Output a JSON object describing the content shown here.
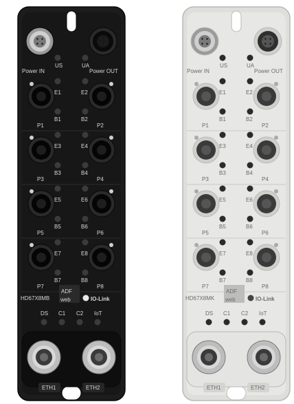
{
  "devices": [
    {
      "variant": "black",
      "labels": {
        "power_in": "Power IN",
        "us": "US",
        "ua": "UA",
        "power_out": "Power OUT",
        "e1": "E1",
        "e2": "E2",
        "b1": "B1",
        "b2": "B2",
        "p1": "P1",
        "p2": "P2",
        "e3": "E3",
        "e4": "E4",
        "b3": "B3",
        "b4": "B4",
        "p3": "P3",
        "p4": "P4",
        "e5": "E5",
        "e6": "E6",
        "b5": "B5",
        "b6": "B6",
        "p5": "P5",
        "p6": "P6",
        "e7": "E7",
        "e8": "E8",
        "b7": "B7",
        "b8": "B8",
        "p7": "P7",
        "p8": "P8",
        "model": "HD67X8MB",
        "brand_top": "ADF",
        "brand_bottom": "web",
        "iolink": "IO-Link",
        "ds": "DS",
        "c1": "C1",
        "c2": "C2",
        "iot": "IoT",
        "eth1": "ETH1",
        "eth2": "ETH2"
      }
    },
    {
      "variant": "white",
      "labels": {
        "power_in": "Power IN",
        "us": "US",
        "ua": "UA",
        "power_out": "Power OUT",
        "e1": "E1",
        "e2": "E2",
        "b1": "B1",
        "b2": "B2",
        "p1": "P1",
        "p2": "P2",
        "e3": "E3",
        "e4": "E4",
        "b3": "B3",
        "b4": "B4",
        "p3": "P3",
        "p4": "P4",
        "e5": "E5",
        "e6": "E6",
        "b5": "B5",
        "b6": "B6",
        "p5": "P5",
        "p6": "P6",
        "e7": "E7",
        "e8": "E8",
        "b7": "B7",
        "b8": "B8",
        "p7": "P7",
        "p8": "P8",
        "model": "HD67X8MK",
        "brand_top": "ADF",
        "brand_bottom": "web",
        "iolink": "IO-Link",
        "ds": "DS",
        "c1": "C1",
        "c2": "C2",
        "iot": "IoT",
        "eth1": "ETH1",
        "eth2": "ETH2"
      }
    }
  ],
  "colors": {
    "black_body": "#1b1b1b",
    "black_panel": "#111111",
    "white_body": "#dcdcda",
    "white_panel": "#ececea",
    "accent": "#333333"
  }
}
